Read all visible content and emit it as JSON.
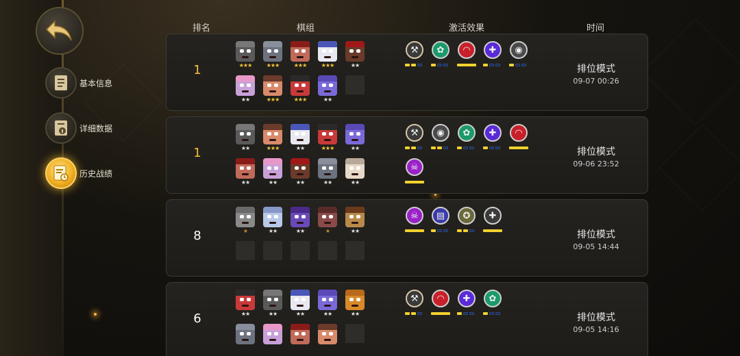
{
  "sidebar": {
    "nav": [
      {
        "label": "基本信息",
        "icon": "document-icon"
      },
      {
        "label": "详细数据",
        "icon": "info-document-icon"
      },
      {
        "label": "历史战绩",
        "icon": "history-clock-icon",
        "active": true
      }
    ]
  },
  "header": {
    "rank": "排名",
    "lineup": "棋组",
    "traits": "激活效果",
    "time": "时间"
  },
  "records": [
    {
      "rank": "1",
      "units": [
        {
          "c": "#5a5a5a",
          "h": "#777",
          "stars": 3
        },
        {
          "c": "#6d7280",
          "h": "#888e9c",
          "stars": 3
        },
        {
          "c": "#c06a5a",
          "h": "#8a1c18",
          "stars": 3
        },
        {
          "c": "#e8e8f0",
          "h": "#4a56b8",
          "stars": 3
        },
        {
          "c": "#6a3b2a",
          "h": "#a01818",
          "stars": 2
        },
        {
          "c": "#c8a0d8",
          "h": "#e898c8",
          "stars": 2
        },
        {
          "c": "#d88a6a",
          "h": "#6a3a2a",
          "stars": 3
        },
        {
          "c": "#c83a3a",
          "h": "#2a2a2a",
          "stars": 3
        },
        {
          "c": "#7a6ad8",
          "h": "#5a4ab8",
          "stars": 2
        },
        null
      ],
      "traits": [
        {
          "color": "#3a3a3a",
          "ring": "#d8c8a8",
          "glyph": "⚒",
          "bar": [
            1,
            1,
            0
          ]
        },
        {
          "color": "#1a9a6a",
          "ring": "#cfcfcf",
          "glyph": "✿",
          "bar": [
            1,
            0,
            0
          ]
        },
        {
          "color": "#c8202a",
          "ring": "#cfcfcf",
          "glyph": "◠",
          "bar": "solid"
        },
        {
          "color": "#5a2ad8",
          "ring": "#cfcfcf",
          "glyph": "✚",
          "bar": [
            1,
            0,
            0
          ]
        },
        {
          "color": "#4a4a4a",
          "ring": "#cfcfcf",
          "glyph": "◉",
          "bar": [
            1,
            0,
            0
          ]
        }
      ],
      "mode": "排位模式",
      "time": "09-07 00:26"
    },
    {
      "rank": "1",
      "units": [
        {
          "c": "#5a5a5a",
          "h": "#777",
          "stars": 2
        },
        {
          "c": "#d88a6a",
          "h": "#6a3a2a",
          "stars": 3
        },
        {
          "c": "#e8e8f0",
          "h": "#4a56b8",
          "stars": 2
        },
        {
          "c": "#c83a3a",
          "h": "#2a2a2a",
          "stars": 3
        },
        {
          "c": "#7a6ad8",
          "h": "#5a4ab8",
          "stars": 2
        },
        {
          "c": "#c06a5a",
          "h": "#8a1c18",
          "stars": 2
        },
        {
          "c": "#c8a0d8",
          "h": "#e898c8",
          "stars": 2
        },
        {
          "c": "#6a3b2a",
          "h": "#a01818",
          "stars": 2
        },
        {
          "c": "#6d7280",
          "h": "#888e9c",
          "stars": 2
        },
        {
          "c": "#e8d8c8",
          "h": "#b8a898",
          "stars": 2
        }
      ],
      "traits": [
        {
          "color": "#3a3a3a",
          "ring": "#d8c8a8",
          "glyph": "⚒",
          "bar": [
            1,
            1,
            0
          ]
        },
        {
          "color": "#4a4a4a",
          "ring": "#cfcfcf",
          "glyph": "◉",
          "bar": [
            1,
            1,
            0
          ]
        },
        {
          "color": "#1a9a6a",
          "ring": "#cfcfcf",
          "glyph": "✿",
          "bar": [
            1,
            0,
            0
          ]
        },
        {
          "color": "#5a2ad8",
          "ring": "#cfcfcf",
          "glyph": "✚",
          "bar": [
            1,
            0,
            0
          ]
        },
        {
          "color": "#c8202a",
          "ring": "#cfcfcf",
          "glyph": "◠",
          "bar": "solid"
        },
        {
          "color": "#9a20c8",
          "ring": "#cfcfcf",
          "glyph": "☠",
          "bar": "solid"
        }
      ],
      "mode": "排位模式",
      "time": "09-06 23:52"
    },
    {
      "rank": "8",
      "units": [
        {
          "c": "#8a8a8a",
          "h": "#6a6a6a",
          "stars": 1
        },
        {
          "c": "#b8c8e8",
          "h": "#8898c8",
          "stars": 2
        },
        {
          "c": "#6a4ab8",
          "h": "#4a2a8a",
          "stars": 2
        },
        {
          "c": "#8a4a4a",
          "h": "#5a2a2a",
          "stars": 1
        },
        {
          "c": "#b88a4a",
          "h": "#6a3a1a",
          "stars": 2
        },
        null,
        null,
        null,
        null,
        null
      ],
      "traits": [
        {
          "color": "#9a20c8",
          "ring": "#cfcfcf",
          "glyph": "☠",
          "bar": "solid"
        },
        {
          "color": "#3a3aa8",
          "ring": "#cfcfcf",
          "glyph": "▤",
          "bar": [
            1,
            0,
            0
          ]
        },
        {
          "color": "#6a6a3a",
          "ring": "#cfcfcf",
          "glyph": "✪",
          "bar": [
            1,
            1,
            0
          ]
        },
        {
          "color": "#3a3a3a",
          "ring": "#cfcfcf",
          "glyph": "✚",
          "bar": "solid"
        }
      ],
      "mode": "排位模式",
      "time": "09-05 14:44"
    },
    {
      "rank": "6",
      "units": [
        {
          "c": "#c83a3a",
          "h": "#2a2a2a",
          "stars": 2
        },
        {
          "c": "#5a5a5a",
          "h": "#777",
          "stars": 2
        },
        {
          "c": "#e8e8f0",
          "h": "#4a56b8",
          "stars": 2
        },
        {
          "c": "#7a6ad8",
          "h": "#5a4ab8",
          "stars": 2
        },
        {
          "c": "#d88a2a",
          "h": "#b86a1a",
          "stars": 2
        },
        {
          "c": "#6d7280",
          "h": "#888e9c",
          "stars": 0
        },
        {
          "c": "#c8a0d8",
          "h": "#e898c8",
          "stars": 0
        },
        {
          "c": "#c06a5a",
          "h": "#8a1c18",
          "stars": 0
        },
        {
          "c": "#d88a6a",
          "h": "#6a3a2a",
          "stars": 0
        },
        null
      ],
      "traits": [
        {
          "color": "#3a3a3a",
          "ring": "#d8c8a8",
          "glyph": "⚒",
          "bar": [
            1,
            1,
            0
          ]
        },
        {
          "color": "#c8202a",
          "ring": "#cfcfcf",
          "glyph": "◠",
          "bar": "solid"
        },
        {
          "color": "#5a2ad8",
          "ring": "#cfcfcf",
          "glyph": "✚",
          "bar": [
            1,
            0,
            0
          ]
        },
        {
          "color": "#1a9a6a",
          "ring": "#cfcfcf",
          "glyph": "✿",
          "bar": [
            1,
            0,
            0
          ]
        }
      ],
      "mode": "排位模式",
      "time": "09-05 14:16"
    }
  ]
}
